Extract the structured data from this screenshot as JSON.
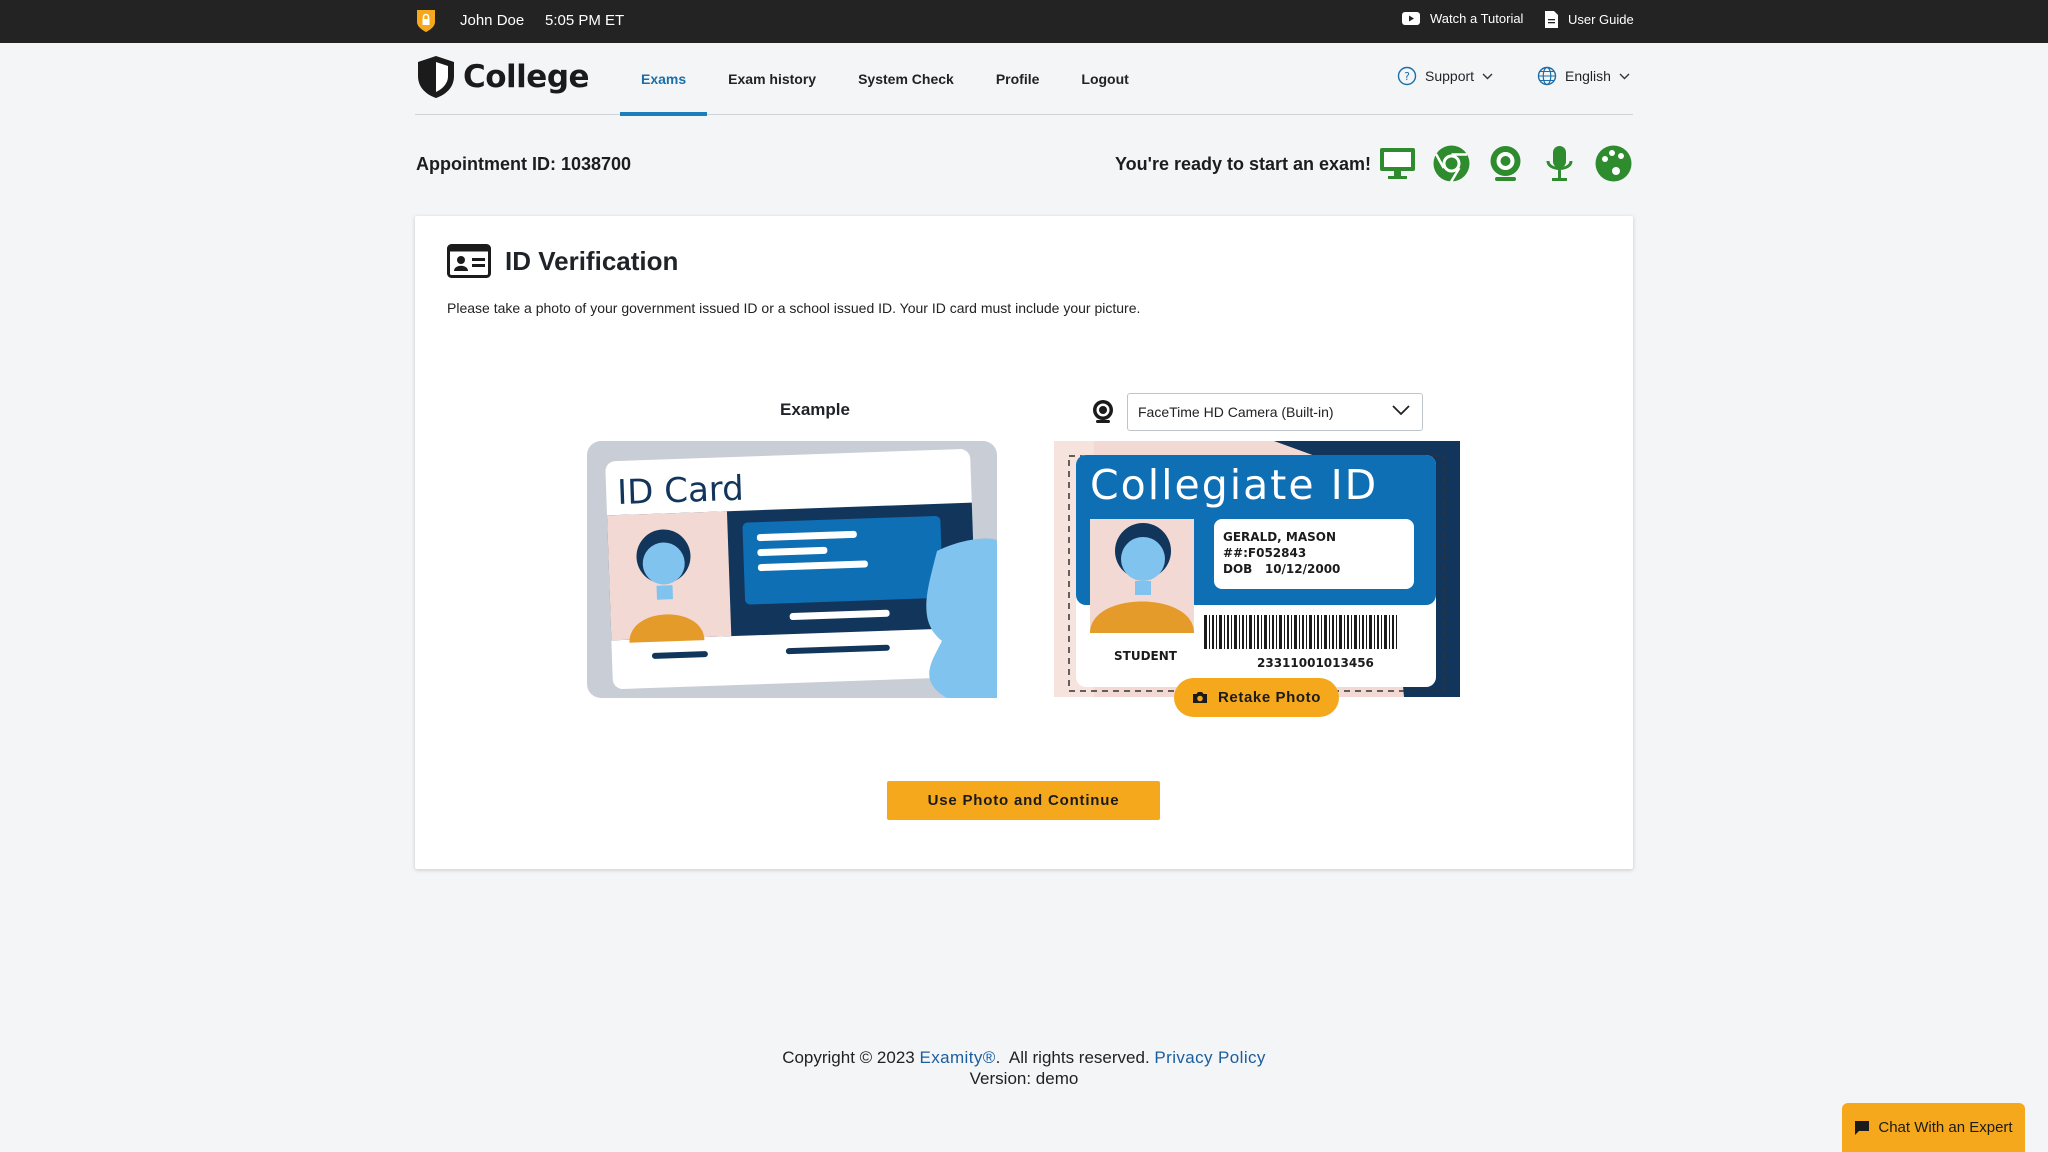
{
  "topbar": {
    "user_name": "John Doe",
    "time": "5:05 PM ET",
    "tutorial_label": "Watch a Tutorial",
    "guide_label": "User Guide"
  },
  "nav": {
    "logo_text": "College",
    "links": [
      "Exams",
      "Exam history",
      "System Check",
      "Profile",
      "Logout"
    ],
    "active": "Exams",
    "support_label": "Support",
    "language_label": "English"
  },
  "status": {
    "appointment": "Appointment ID: 1038700",
    "ready_text": "You're ready to start an exam!",
    "icons": [
      "monitor-icon",
      "chrome-icon",
      "webcam-icon",
      "microphone-icon",
      "palette-icon"
    ],
    "icon_color": "#2e8b2e"
  },
  "card": {
    "title": "ID Verification",
    "description": "Please take a photo of your government issued ID or a school issued ID. Your ID card must include your picture.",
    "example_label": "Example",
    "example_card_title": "ID Card",
    "camera_selected": "FaceTime HD Camera (Built-in)",
    "captured_id": {
      "title": "Collegiate ID",
      "name": "GERALD, MASON",
      "number": "##:F052843",
      "dob": "DOB   10/12/2000",
      "role": "STUDENT",
      "barcode": "23311001013456"
    },
    "retake_label": "Retake Photo",
    "continue_label": "Use Photo and Continue"
  },
  "footer": {
    "copyright": "Copyright © 2023",
    "brand": "Examity®",
    "rights": ".  All rights reserved.",
    "privacy": "Privacy Policy",
    "version": "Version: demo"
  },
  "chat_label": "Chat With an Expert",
  "colors": {
    "accent": "#f5a81c",
    "link": "#1b5ea0",
    "nav_active": "#1b7fbd",
    "topbar": "#232323"
  }
}
